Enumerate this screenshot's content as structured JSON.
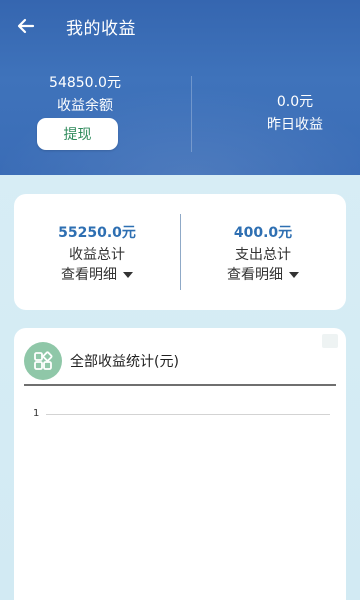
{
  "header": {
    "title": "我的收益",
    "balance_amount": "54850.0元",
    "balance_label": "收益余额",
    "withdraw_label": "提现",
    "yesterday_amount": "0.0元",
    "yesterday_label": "昨日收益"
  },
  "summary": {
    "income_amount": "55250.0元",
    "income_label": "收益总计",
    "income_detail": "查看明细",
    "expense_amount": "400.0元",
    "expense_label": "支出总计",
    "expense_detail": "查看明细"
  },
  "stats": {
    "title": "全部收益统计(元)",
    "tick": "1"
  },
  "colors": {
    "header_bg": "#3a6cb6",
    "accent_blue": "#2e6fb2",
    "withdraw_text": "#2f8a5b",
    "stats_icon_bg": "#8fc7a8",
    "page_bg": "#d6ecf5"
  },
  "icons": {
    "back": "arrow-left-icon",
    "stats": "apps-grid-icon"
  }
}
